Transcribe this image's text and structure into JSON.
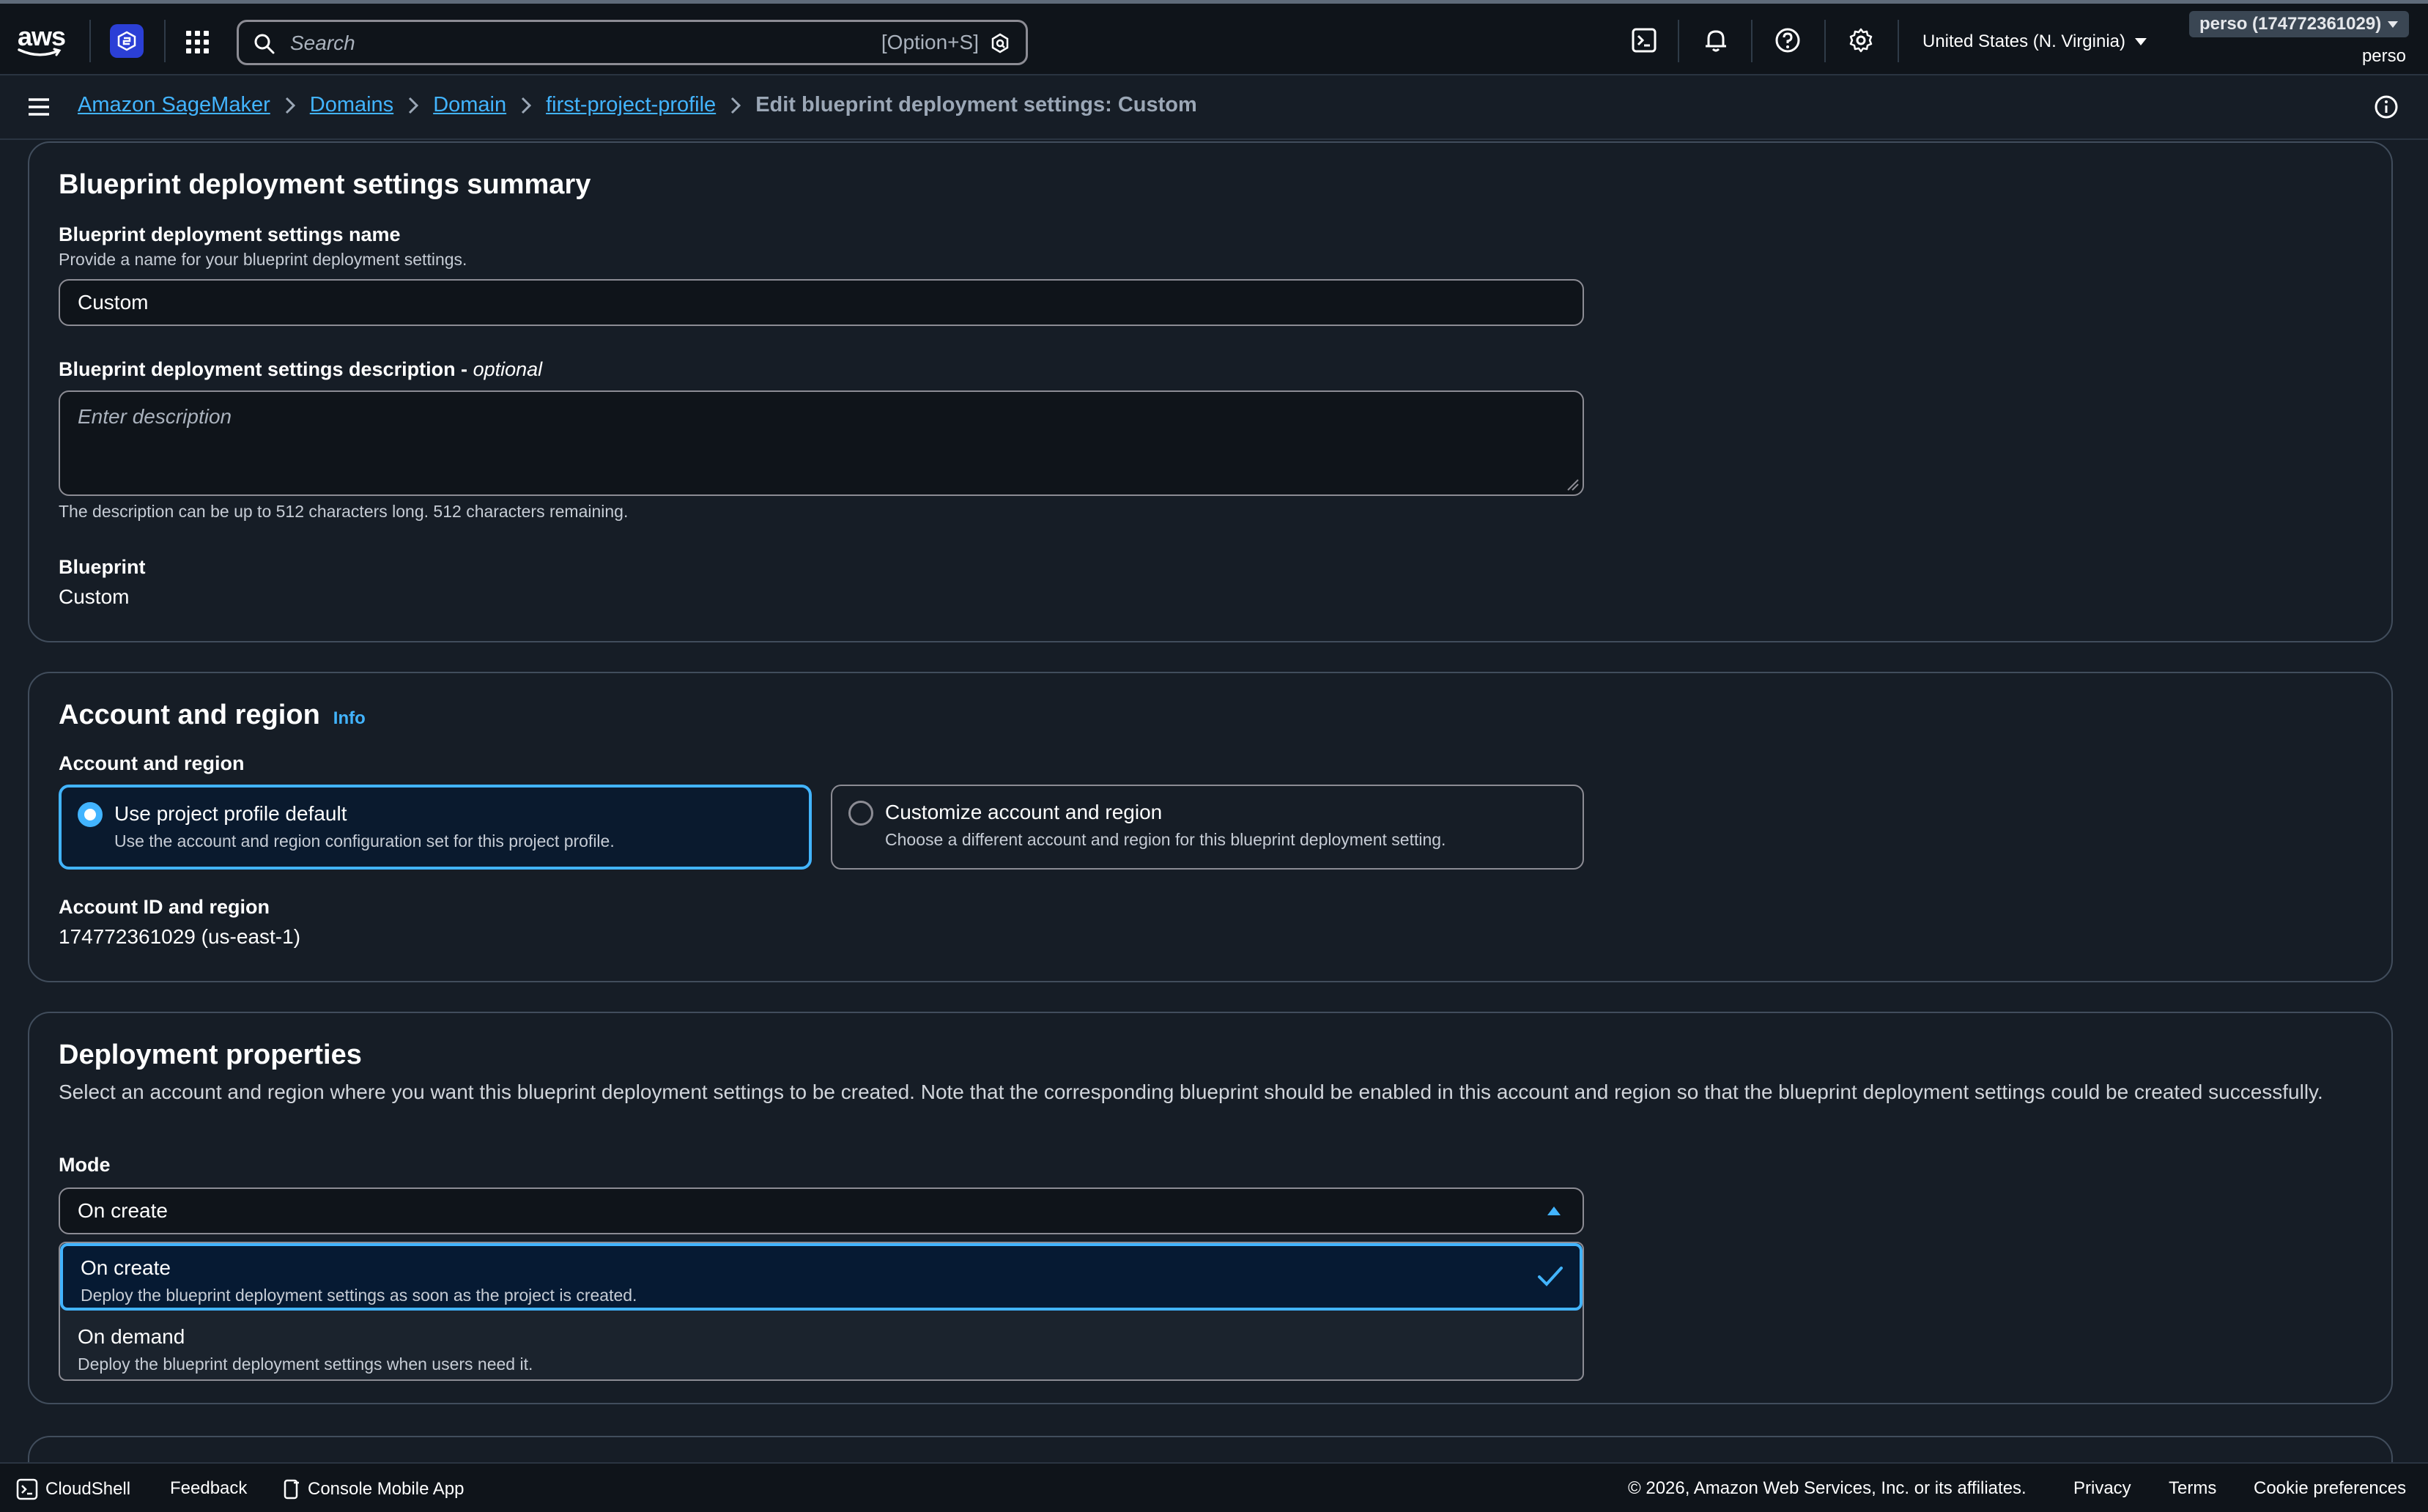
{
  "topnav": {
    "logo_text": "aws",
    "search_placeholder": "Search",
    "search_shortcut": "[Option+S]",
    "region_label": "United States (N. Virginia)",
    "account_badge": "perso (174772361029)",
    "account_user": "perso"
  },
  "breadcrumb": {
    "items": [
      "Amazon SageMaker",
      "Domains",
      "Domain",
      "first-project-profile"
    ],
    "current": "Edit blueprint deployment settings: Custom"
  },
  "summary": {
    "title": "Blueprint deployment settings summary",
    "name_label": "Blueprint deployment settings name",
    "name_desc": "Provide a name for your blueprint deployment settings.",
    "name_value": "Custom",
    "description_label": "Blueprint deployment settings description - ",
    "description_optional": "optional",
    "description_placeholder": "Enter description",
    "description_hint": "The description can be up to 512 characters long. 512 characters remaining.",
    "blueprint_label": "Blueprint",
    "blueprint_value": "Custom"
  },
  "account_region": {
    "title": "Account and region",
    "info": "Info",
    "field_label": "Account and region",
    "options": [
      {
        "title": "Use project profile default",
        "desc": "Use the account and region configuration set for this project profile.",
        "selected": true
      },
      {
        "title": "Customize account and region",
        "desc": "Choose a different account and region for this blueprint deployment setting.",
        "selected": false
      }
    ],
    "account_id_label": "Account ID and region",
    "account_id_value": "174772361029 (us-east-1)"
  },
  "deployment": {
    "title": "Deployment properties",
    "desc": "Select an account and region where you want this blueprint deployment settings to be created. Note that the corresponding blueprint should be enabled in this account and region so that the blueprint deployment settings could be created successfully.",
    "mode_label": "Mode",
    "mode_value": "On create",
    "options": [
      {
        "title": "On create",
        "desc": "Deploy the blueprint deployment settings as soon as the project is created.",
        "selected": true
      },
      {
        "title": "On demand",
        "desc": "Deploy the blueprint deployment settings when users need it.",
        "selected": false
      }
    ]
  },
  "footer": {
    "cloudshell": "CloudShell",
    "feedback": "Feedback",
    "mobile_app": "Console Mobile App",
    "copyright": "© 2026, Amazon Web Services, Inc. or its affiliates.",
    "privacy": "Privacy",
    "terms": "Terms",
    "cookies": "Cookie preferences"
  },
  "colors": {
    "accent": "#42b4ff",
    "background": "#161d26",
    "nav": "#0f141a",
    "sagemaker": "#2b3fd6"
  }
}
